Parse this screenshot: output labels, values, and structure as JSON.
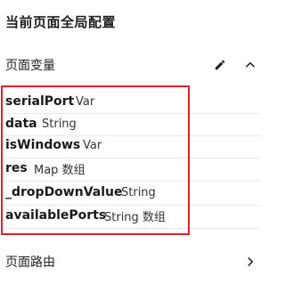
{
  "page": {
    "title": "当前页面全局配置"
  },
  "variables_section": {
    "label": "页面变量",
    "edit_icon": "pencil-icon",
    "collapse_icon": "chevron-up-icon"
  },
  "variables": [
    {
      "name": "serialPort",
      "type": "Var"
    },
    {
      "name": "data",
      "type": "String"
    },
    {
      "name": "isWindows",
      "type": "Var"
    },
    {
      "name": "res",
      "type": "Map 数组"
    },
    {
      "name": "_dropDownValue",
      "type": "String"
    },
    {
      "name": "availablePorts",
      "type": "String 数组"
    }
  ],
  "route_section": {
    "label": "页面路由",
    "expand_icon": "chevron-right-icon"
  },
  "colors": {
    "highlight_border": "#d9232d",
    "divider": "#e8e8e8"
  }
}
